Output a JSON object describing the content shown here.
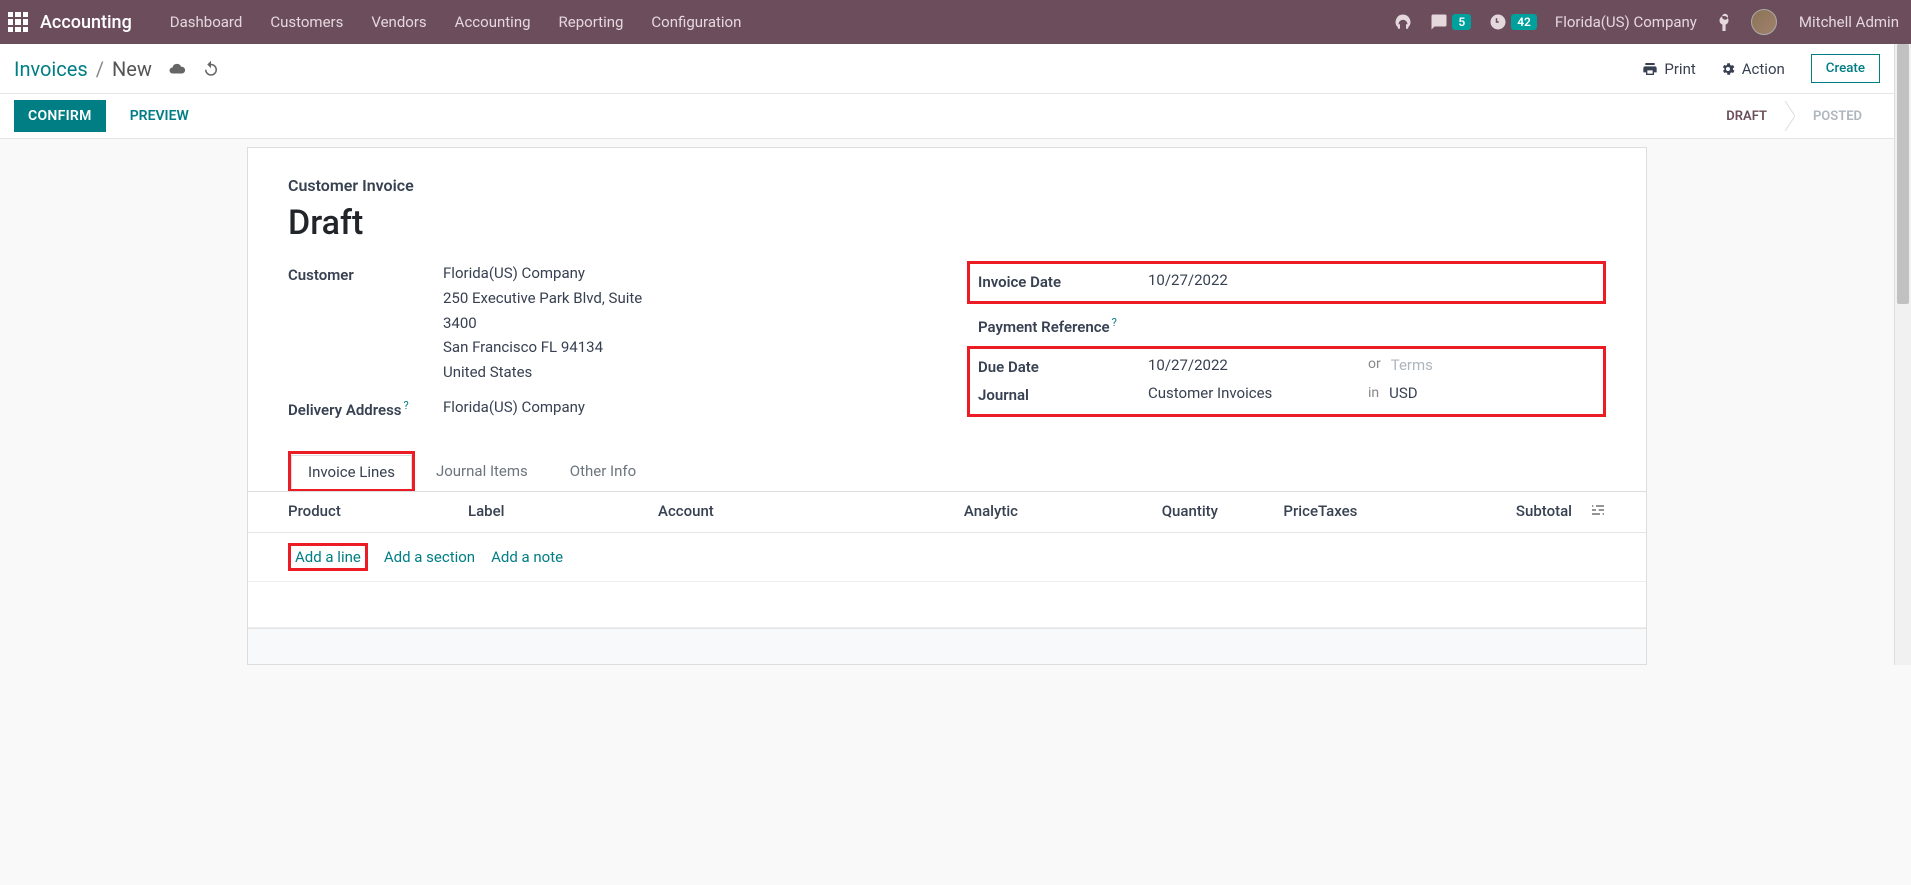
{
  "topnav": {
    "app_title": "Accounting",
    "items": [
      "Dashboard",
      "Customers",
      "Vendors",
      "Accounting",
      "Reporting",
      "Configuration"
    ],
    "msg_badge": "5",
    "clock_badge": "42",
    "company": "Florida(US) Company",
    "user": "Mitchell Admin"
  },
  "breadcrumb": {
    "root": "Invoices",
    "current": "New",
    "print": "Print",
    "action": "Action",
    "create": "Create"
  },
  "statusbar": {
    "confirm": "CONFIRM",
    "preview": "PREVIEW",
    "states": [
      "DRAFT",
      "POSTED"
    ],
    "active_index": 0
  },
  "form": {
    "subtitle": "Customer Invoice",
    "title": "Draft",
    "left": {
      "customer_label": "Customer",
      "customer_name": "Florida(US) Company",
      "addr1": "250 Executive Park Blvd, Suite",
      "addr2": "3400",
      "addr3": "San Francisco FL 94134",
      "addr4": "United States",
      "delivery_label": "Delivery Address",
      "delivery_value": "Florida(US) Company"
    },
    "right": {
      "invoice_date_label": "Invoice Date",
      "invoice_date": "10/27/2022",
      "payment_ref_label": "Payment Reference",
      "due_date_label": "Due Date",
      "due_date": "10/27/2022",
      "or_text": "or",
      "terms_placeholder": "Terms",
      "journal_label": "Journal",
      "journal_value": "Customer Invoices",
      "in_text": "in",
      "currency": "USD"
    }
  },
  "tabs": [
    "Invoice Lines",
    "Journal Items",
    "Other Info"
  ],
  "grid": {
    "headers": {
      "product": "Product",
      "label": "Label",
      "account": "Account",
      "analytic": "Analytic",
      "quantity": "Quantity",
      "price": "Price",
      "taxes": "Taxes",
      "subtotal": "Subtotal"
    },
    "add_line": "Add a line",
    "add_section": "Add a section",
    "add_note": "Add a note"
  }
}
